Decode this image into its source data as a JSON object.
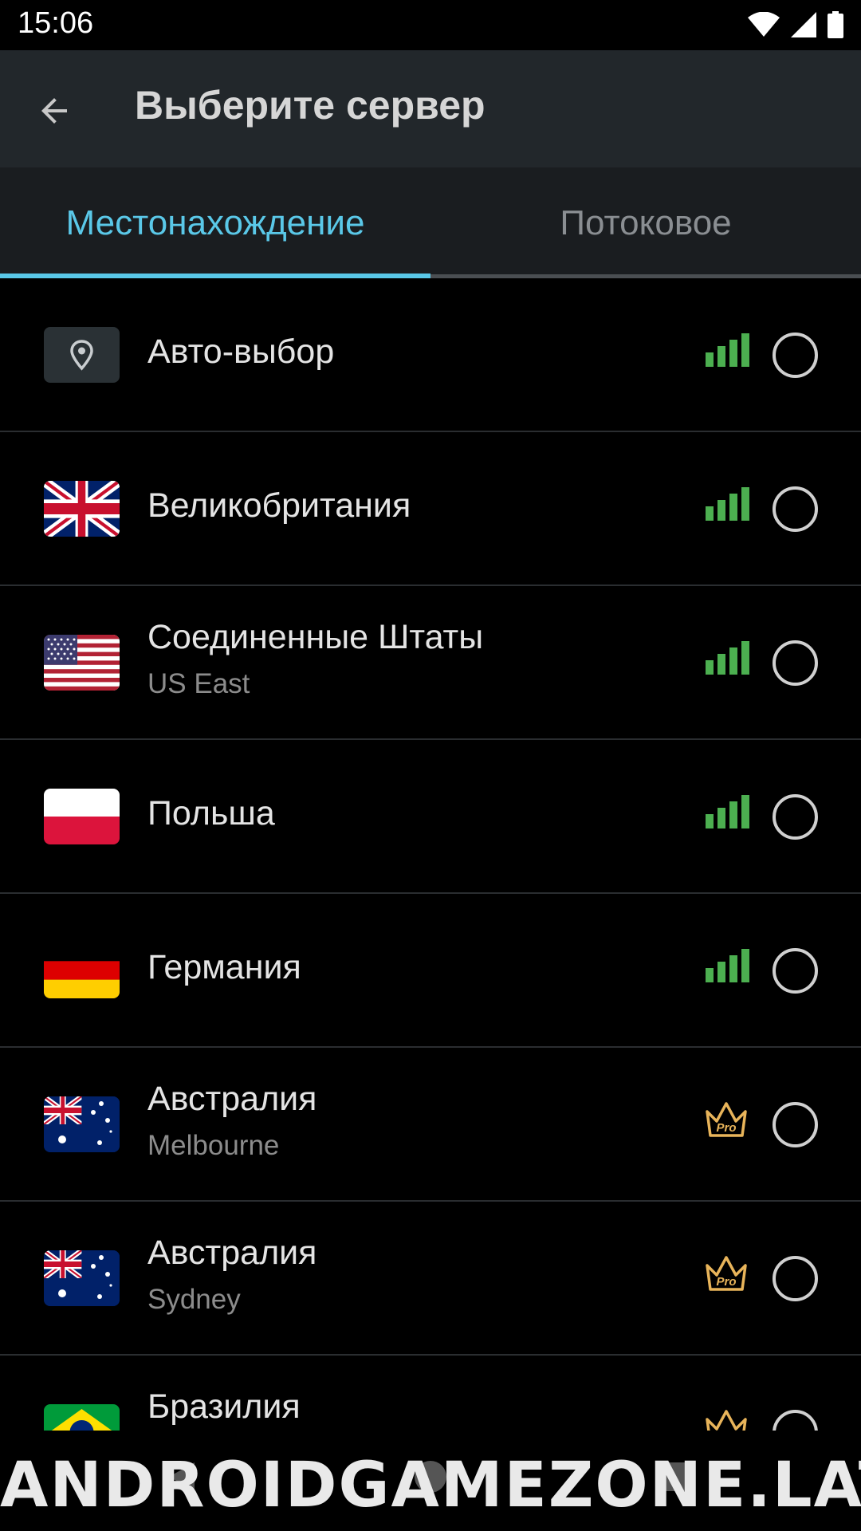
{
  "status_bar": {
    "time": "15:06"
  },
  "app_bar": {
    "title": "Выберите сервер"
  },
  "tabs": [
    {
      "label": "Местонахождение",
      "active": true
    },
    {
      "label": "Потоковое",
      "active": false
    }
  ],
  "servers": [
    {
      "name": "Авто-выбор",
      "subtitle": "",
      "icon": "location-pin-icon",
      "badge": "signal"
    },
    {
      "name": "Великобритания",
      "subtitle": "",
      "icon": "uk-flag",
      "badge": "signal"
    },
    {
      "name": "Соединенные Штаты",
      "subtitle": "US East",
      "icon": "us-flag",
      "badge": "signal"
    },
    {
      "name": "Польша",
      "subtitle": "",
      "icon": "poland-flag",
      "badge": "signal"
    },
    {
      "name": "Германия",
      "subtitle": "",
      "icon": "germany-flag",
      "badge": "signal"
    },
    {
      "name": "Австралия",
      "subtitle": "Melbourne",
      "icon": "australia-flag",
      "badge": "pro"
    },
    {
      "name": "Австралия",
      "subtitle": "Sydney",
      "icon": "australia-flag",
      "badge": "pro"
    },
    {
      "name": "Бразилия",
      "subtitle": "",
      "icon": "brazil-flag",
      "badge": "pro"
    }
  ],
  "pro_badge_text": "Pro",
  "watermark": "ANDROIDGAMEZONE.LAT",
  "colors": {
    "accent": "#5ac8e8",
    "signal": "#4caf50",
    "pro": "#e8b45a",
    "app_bar": "#22272b",
    "background": "#000000"
  }
}
